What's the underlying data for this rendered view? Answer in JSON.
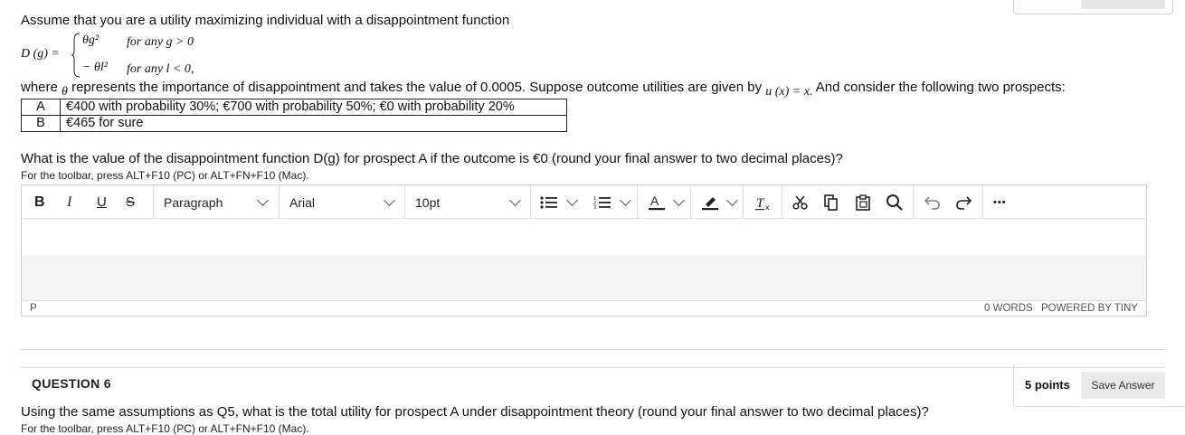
{
  "intro": "Assume that you are a utility maximizing individual with a disappointment function",
  "formula": {
    "lhs": "D (g) =",
    "case1_expr": "θg²",
    "case1_cond": "for any g > 0",
    "case2_expr": "− θl²",
    "case2_cond": "for any l < 0,"
  },
  "where_line": {
    "pre": "where",
    "theta": "θ",
    "mid": "represents the importance of disappointment and takes the value of 0.0005. Suppose outcome utilities are given by",
    "utility": "u (x) = x.",
    "post": "And consider the following two prospects:"
  },
  "prospects": [
    {
      "label": "A",
      "desc": "€400 with probability 30%; €700 with probability 50%; €0 with probability 20%"
    },
    {
      "label": "B",
      "desc": "€465 for sure"
    }
  ],
  "question5": "What is the value of the disappointment function D(g) for prospect A if the outcome is €0 (round your final answer to two decimal places)?",
  "toolbar_hint": "For the toolbar, press ALT+F10 (PC) or ALT+FN+F10 (Mac).",
  "editor": {
    "bold": "B",
    "italic": "I",
    "underline": "U",
    "strike": "S",
    "paragraph": "Paragraph",
    "font": "Arial",
    "size": "10pt",
    "more": "•••",
    "status_path": "P",
    "word_count": "0 WORDS",
    "powered": "POWERED BY TINY"
  },
  "question6": {
    "title": "QUESTION 6",
    "points": "5 points",
    "save": "Save Answer",
    "text": "Using the same assumptions as Q5, what is the total utility for prospect A under disappointment theory (round your final answer to two decimal places)?",
    "hint": "For the toolbar, press ALT+F10 (PC) or ALT+FN+F10 (Mac)."
  }
}
